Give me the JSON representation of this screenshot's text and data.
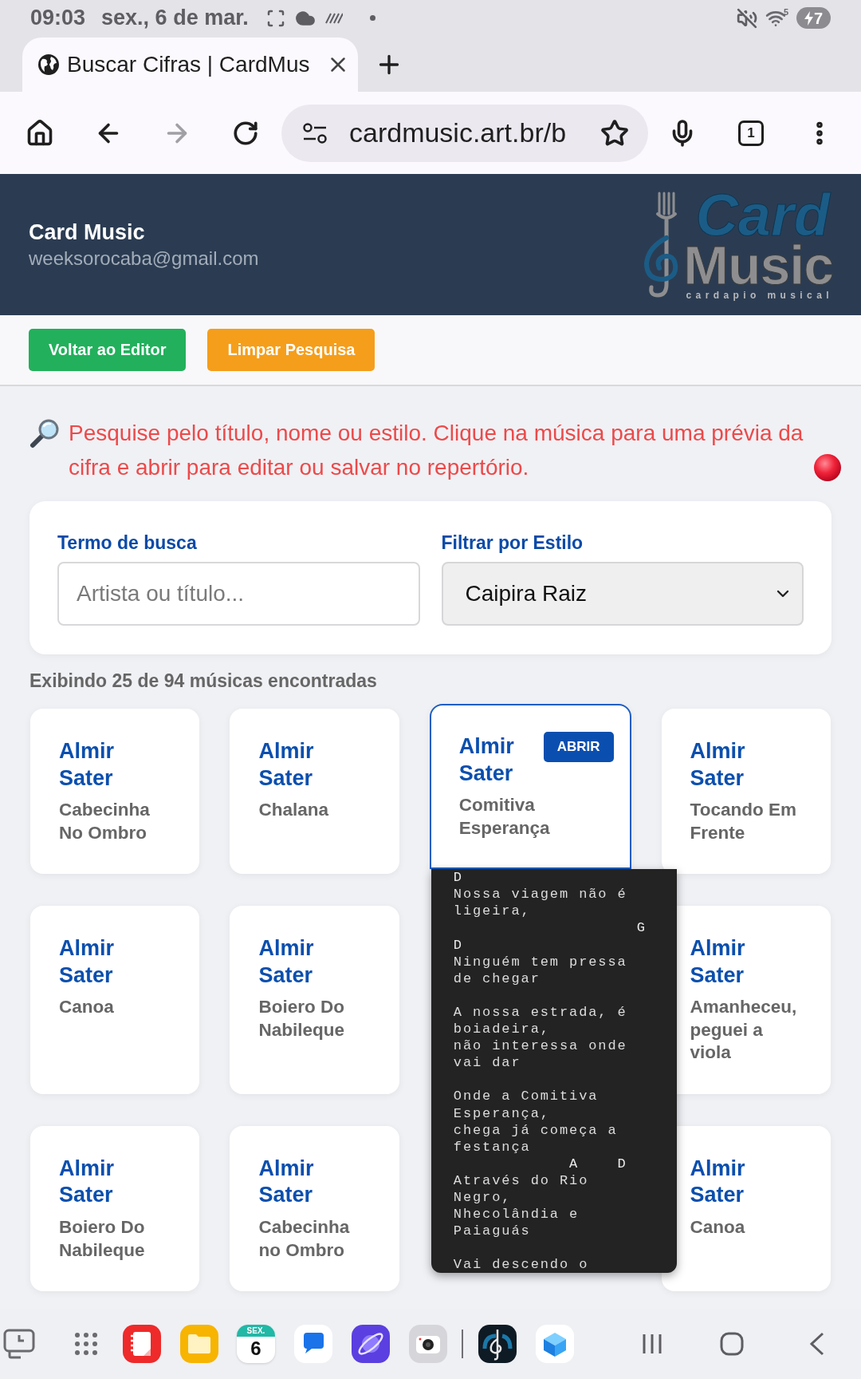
{
  "status_bar": {
    "time": "09:03",
    "date": "sex., 6 de mar.",
    "wifi_badge": "5",
    "battery": "7"
  },
  "browser": {
    "tab": {
      "title": "Buscar Cifras | CardMus",
      "selected": true
    },
    "address": "cardmusic.art.br/b",
    "tab_count": "1"
  },
  "header": {
    "title": "Card Music",
    "email": "weeksorocaba@gmail.com",
    "logo": {
      "line_1": "Card",
      "line_2": "Music",
      "tagline": "cardapio musical"
    }
  },
  "actions": [
    {
      "label": "Voltar ao Editor",
      "color": "#22b05c"
    },
    {
      "label": "Limpar Pesquisa",
      "color": "#f59e1b"
    }
  ],
  "hint": "Pesquise pelo título, nome ou estilo. Clique na música para uma prévia da cifra e abrir para editar ou salvar no repertório.",
  "search": {
    "fields": [
      {
        "kind": "text",
        "label": "Termo de busca",
        "placeholder": "Artista ou título..."
      },
      {
        "kind": "select",
        "label": "Filtrar por Estilo",
        "value": "Caipira Raiz"
      }
    ]
  },
  "result_count": "Exibindo 25 de 94 músicas encontradas",
  "songs": [
    {
      "artist": "Almir Sater",
      "title": "Cabecinha No Ombro",
      "selected": false
    },
    {
      "artist": "Almir Sater",
      "title": "Chalana",
      "selected": false
    },
    {
      "artist": "Almir Sater",
      "title": "Comitiva Esperança",
      "selected": true,
      "action": "ABRIR"
    },
    {
      "artist": "Almir Sater",
      "title": "Tocando Em Frente",
      "selected": false
    },
    {
      "artist": "Almir Sater",
      "title": "Canoa",
      "selected": false
    },
    {
      "artist": "Almir Sater",
      "title": "Boiero Do Nabileque",
      "selected": false
    },
    {
      "artist": "Almir Sater",
      "title": "Amanheceu, peguei a viola",
      "selected": false
    },
    {
      "artist": "Almir Sater",
      "title": "Boiero Do Nabileque",
      "selected": false
    },
    {
      "artist": "Almir Sater",
      "title": "Cabecinha no Ombro",
      "selected": false
    },
    {
      "artist": "Almir Sater",
      "title": "Canoa",
      "selected": false
    }
  ],
  "preview": {
    "stanzas": [
      {
        "lines": [
          {
            "kind": "chord",
            "text": "D"
          },
          {
            "kind": "lyric",
            "text": "Nossa viagem não é"
          },
          {
            "kind": "lyric",
            "text": "ligeira,"
          },
          {
            "kind": "chord",
            "text": "                   G"
          },
          {
            "kind": "chord",
            "text": "D"
          },
          {
            "kind": "lyric",
            "text": "Ninguém tem pressa"
          },
          {
            "kind": "lyric",
            "text": "de chegar"
          }
        ]
      },
      {
        "lines": [
          {
            "kind": "lyric",
            "text": "A nossa estrada, é"
          },
          {
            "kind": "lyric",
            "text": "boiadeira,"
          },
          {
            "kind": "lyric",
            "text": "não interessa onde"
          },
          {
            "kind": "lyric",
            "text": "vai dar"
          }
        ]
      },
      {
        "lines": [
          {
            "kind": "lyric",
            "text": "Onde a Comitiva"
          },
          {
            "kind": "lyric",
            "text": "Esperança,"
          },
          {
            "kind": "lyric",
            "text": "chega já começa a"
          },
          {
            "kind": "lyric",
            "text": "festança"
          },
          {
            "kind": "chord",
            "text": "            A    D"
          },
          {
            "kind": "lyric",
            "text": "Através do Rio"
          },
          {
            "kind": "lyric",
            "text": "Negro,"
          },
          {
            "kind": "lyric",
            "text": "Nhecolândia e"
          },
          {
            "kind": "lyric",
            "text": "Paiaguás"
          }
        ]
      },
      {
        "lines": [
          {
            "kind": "lyric",
            "text": "Vai descendo o"
          }
        ]
      }
    ]
  },
  "dock": {
    "calendar_weekday": "SEX.",
    "calendar_day": "6"
  }
}
